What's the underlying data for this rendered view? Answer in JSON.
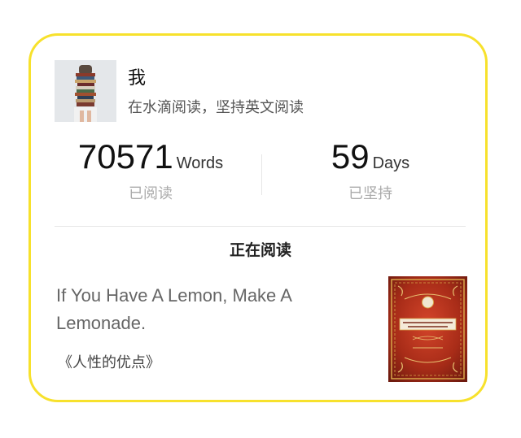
{
  "profile": {
    "name": "我",
    "motto": "在水滴阅读，坚持英文阅读"
  },
  "stats": {
    "words": {
      "value": "70571",
      "unit": "Words",
      "label": "已阅读"
    },
    "days": {
      "value": "59",
      "unit": "Days",
      "label": "已坚持"
    }
  },
  "reading": {
    "section_title": "正在阅读",
    "sentence": "If You Have A Lemon, Make A Lemonade.",
    "book_title": "《人性的优点》"
  },
  "colors": {
    "card_border": "#f7e12c",
    "cover_red": "#b8321c",
    "cover_gold": "#d9a64a"
  }
}
